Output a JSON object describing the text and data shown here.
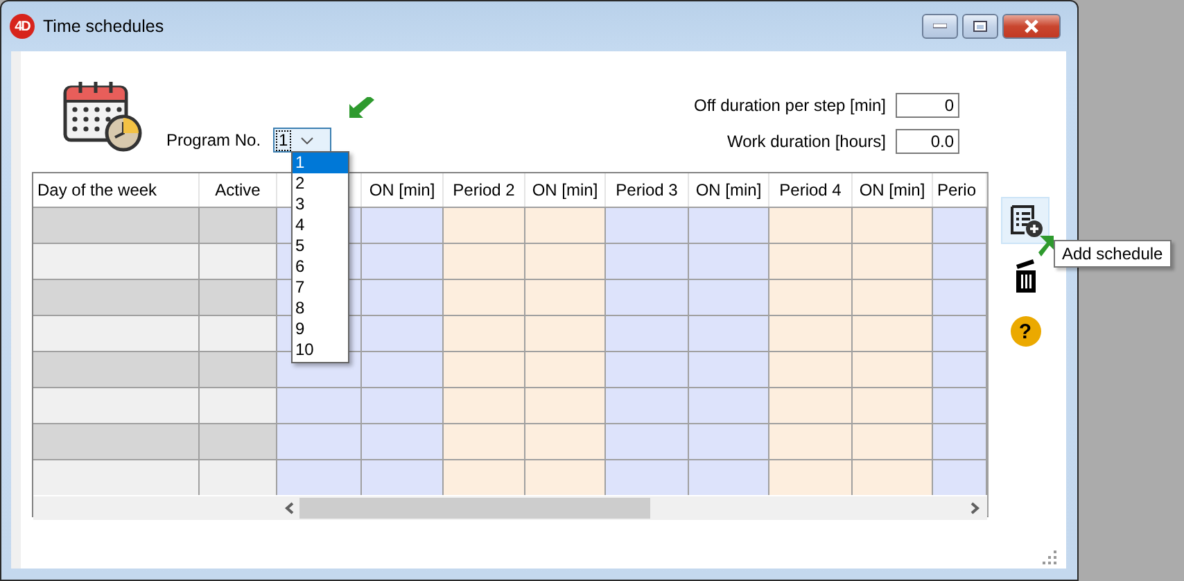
{
  "window": {
    "logo": "4D",
    "title": "Time schedules"
  },
  "program": {
    "label": "Program No.",
    "value": "1",
    "expanded": true,
    "options": [
      {
        "label": "1",
        "selected": true
      },
      {
        "label": "2",
        "selected": false
      },
      {
        "label": "3",
        "selected": false
      },
      {
        "label": "4",
        "selected": false
      },
      {
        "label": "5",
        "selected": false
      },
      {
        "label": "6",
        "selected": false
      },
      {
        "label": "7",
        "selected": false
      },
      {
        "label": "8",
        "selected": false
      },
      {
        "label": "9",
        "selected": false
      },
      {
        "label": "10",
        "selected": false
      }
    ]
  },
  "fields": [
    {
      "label": "Off duration per step [min]",
      "value": "0"
    },
    {
      "label": "Work duration [hours]",
      "value": "0.0"
    }
  ],
  "table": {
    "columns": [
      {
        "label": "Day of the week",
        "kind": "fixed"
      },
      {
        "label": "Active",
        "kind": "fixed"
      },
      {
        "kind": "period",
        "color": "#dde3fb"
      },
      {
        "label": "ON [min]",
        "kind": "period",
        "color": "#dde3fb"
      },
      {
        "label": "Period 2",
        "kind": "period",
        "color": "#fdeede"
      },
      {
        "label": "ON [min]",
        "kind": "period",
        "color": "#fdeede"
      },
      {
        "label": "Period 3",
        "kind": "period",
        "color": "#dde3fb"
      },
      {
        "label": "ON [min]",
        "kind": "period",
        "color": "#dde3fb"
      },
      {
        "label": "Period 4",
        "kind": "period",
        "color": "#fdeede"
      },
      {
        "label": "ON [min]",
        "kind": "period",
        "color": "#fdeede"
      },
      {
        "label": "Perio",
        "kind": "period",
        "color": "#dde3fb"
      }
    ],
    "rows": [
      {
        "shaded": true
      },
      {
        "shaded": false
      },
      {
        "shaded": true
      },
      {
        "shaded": false
      },
      {
        "shaded": true
      },
      {
        "shaded": false
      },
      {
        "shaded": true
      },
      {
        "shaded": false
      }
    ]
  },
  "toolbar": [
    {
      "kind": "add",
      "hovered": true
    },
    {
      "kind": "delete",
      "hovered": false
    },
    {
      "kind": "help",
      "label": "?",
      "hovered": false
    }
  ],
  "tooltip": {
    "text": "Add schedule"
  }
}
